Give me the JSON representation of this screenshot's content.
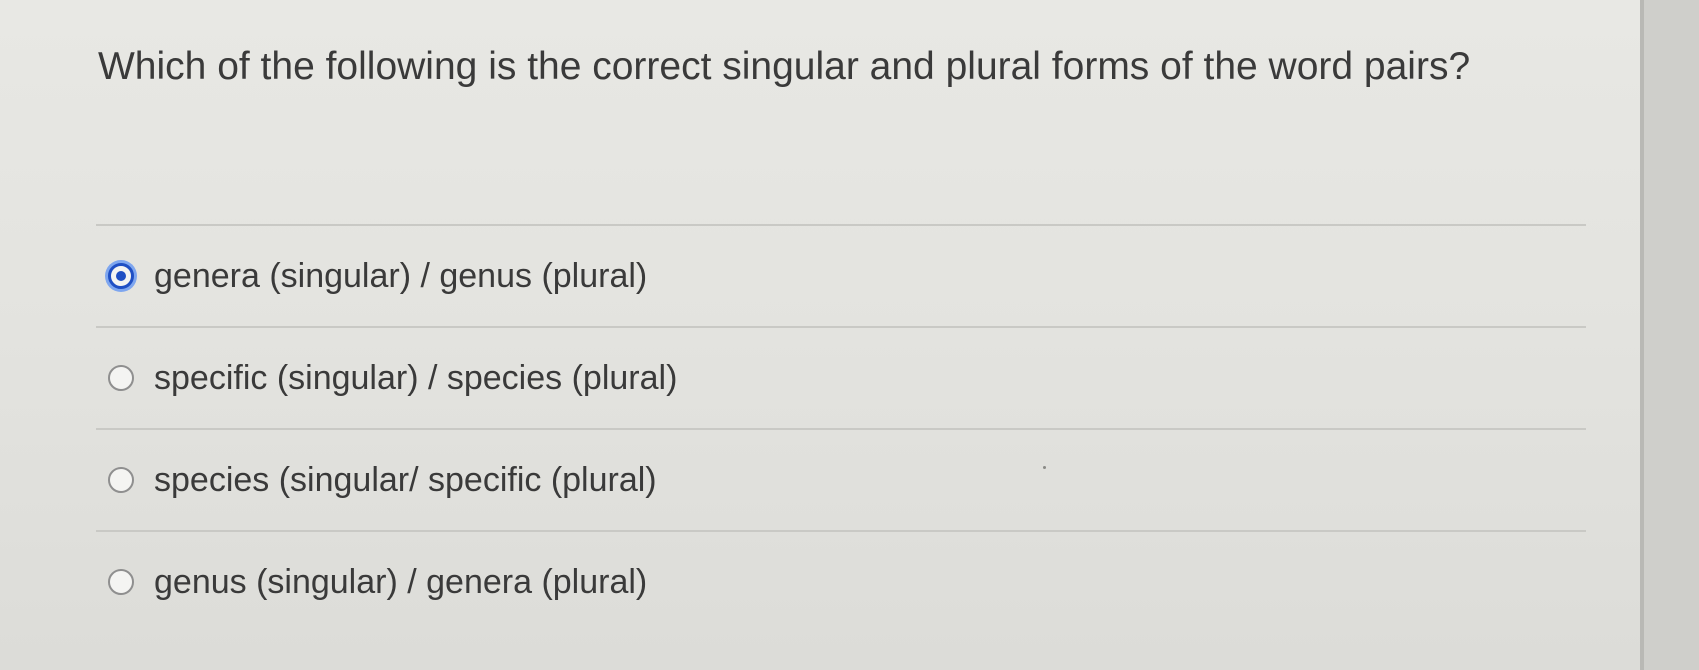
{
  "question": {
    "text": "Which of the following is the correct singular and plural forms of the word pairs?"
  },
  "options": [
    {
      "label": "genera (singular) / genus (plural)",
      "selected": true
    },
    {
      "label": "specific (singular) / species (plural)",
      "selected": false
    },
    {
      "label": "species (singular/ specific (plural)",
      "selected": false
    },
    {
      "label": "genus (singular) / genera (plural)",
      "selected": false
    }
  ],
  "colors": {
    "accent": "#1f4fc4",
    "text": "#3a3a3a",
    "background": "#e5e5e1",
    "divider": "#c9c9c5"
  },
  "icons": {
    "selected": "radio-checked-icon",
    "unselected": "radio-unchecked-icon"
  }
}
